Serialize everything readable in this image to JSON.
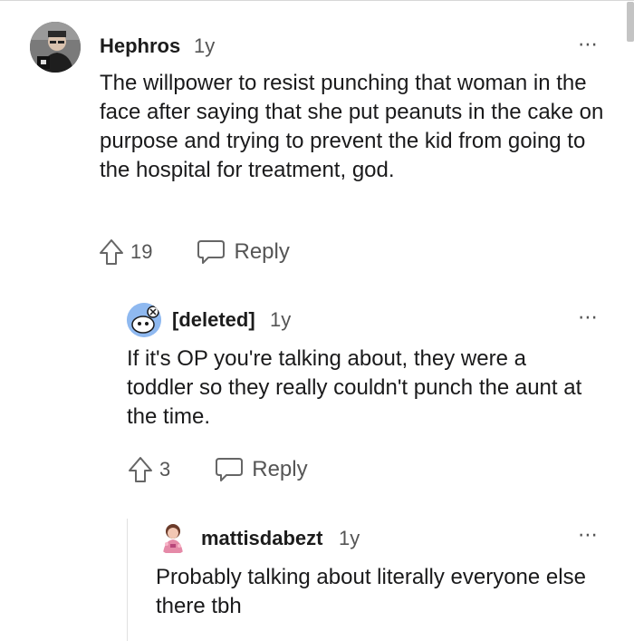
{
  "comments": [
    {
      "author": "Hephros",
      "age": "1y",
      "more_icon": "⋯",
      "body": "The willpower to resist punching that woman in the face after saying that she put peanuts in the cake on purpose and trying to prevent the kid from going to the hospital for treatment, god.",
      "votes": "19",
      "reply_label": "Reply"
    },
    {
      "author": "[deleted]",
      "age": "1y",
      "more_icon": "⋯",
      "body": "If it's OP you're talking about, they were a toddler so they really couldn't punch the aunt at the time.",
      "votes": "3",
      "reply_label": "Reply"
    },
    {
      "author": "mattisdabezt",
      "age": "1y",
      "more_icon": "⋯",
      "body": "Probably talking about literally everyone else there tbh"
    }
  ],
  "colors": {
    "text": "#1a1a1b",
    "meta": "#555555",
    "thread": "#e0e0e0",
    "avatar_blue": "#8fb9f0"
  }
}
